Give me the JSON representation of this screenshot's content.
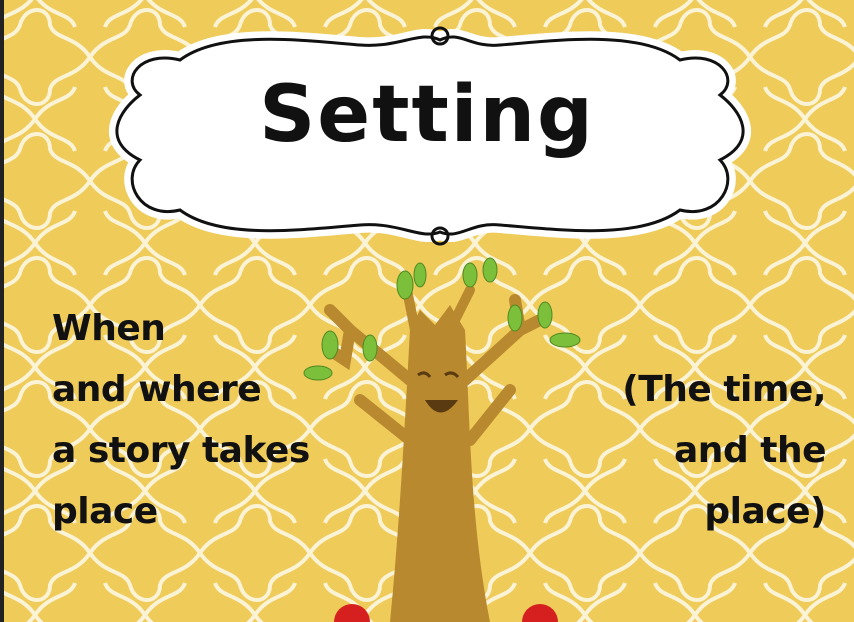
{
  "title": "Setting",
  "left_text": [
    "When",
    "and where",
    "a story takes",
    "place"
  ],
  "right_text": [
    "(The time,",
    "and the",
    "place)"
  ],
  "colors": {
    "background": "#efcb5a",
    "pattern": "#fbf3d6",
    "tree": "#b8892f",
    "leaf": "#7cbf3a",
    "apple": "#d62020"
  }
}
